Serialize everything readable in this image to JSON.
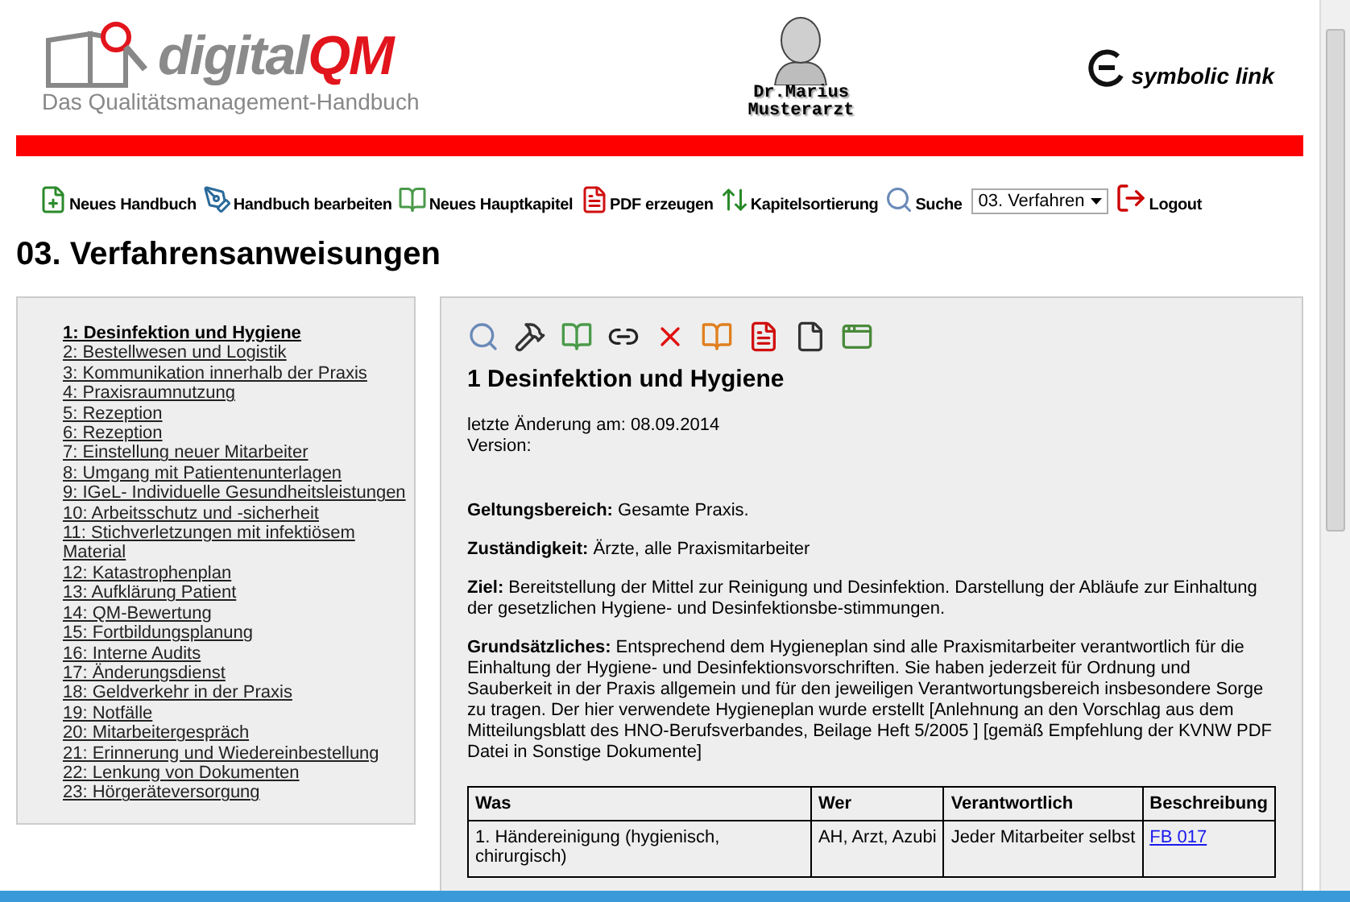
{
  "header": {
    "logo": {
      "brand_plain": "digital",
      "brand_accent": "QM",
      "subtitle": "Das Qualitätsmanagement-Handbuch"
    },
    "center_logo": {
      "line_1": "Dr.Marius",
      "line_2": "Musterarzt"
    },
    "partner_logo": "symbolic link"
  },
  "toolbar": {
    "items": [
      {
        "label": "Neues Handbuch"
      },
      {
        "label": "Handbuch bearbeiten"
      },
      {
        "label": "Neues Hauptkapitel"
      },
      {
        "label": "PDF erzeugen"
      },
      {
        "label": "Kapitelsortierung"
      },
      {
        "label": "Suche"
      }
    ],
    "chapter_select": {
      "value": "03. Verfahren"
    },
    "logout": "Logout"
  },
  "page_title": "03. Verfahrensanweisungen",
  "sidebar": {
    "items": [
      {
        "label": "1: Desinfektion und Hygiene",
        "selected": true
      },
      {
        "label": "2: Bestellwesen und Logistik",
        "selected": false
      },
      {
        "label": "3: Kommunikation innerhalb der Praxis",
        "selected": false
      },
      {
        "label": "4: Praxisraumnutzung",
        "selected": false
      },
      {
        "label": "5: Rezeption",
        "selected": false
      },
      {
        "label": "6: Rezeption",
        "selected": false
      },
      {
        "label": "7: Einstellung neuer Mitarbeiter",
        "selected": false
      },
      {
        "label": "8: Umgang mit Patientenunterlagen",
        "selected": false
      },
      {
        "label": "9: IGeL- Individuelle Gesundheitsleistungen",
        "selected": false
      },
      {
        "label": "10: Arbeitsschutz und -sicherheit",
        "selected": false
      },
      {
        "label": "11: Stichverletzungen mit infektiösem Material",
        "selected": false
      },
      {
        "label": "12: Katastrophenplan",
        "selected": false
      },
      {
        "label": "13: Aufklärung Patient",
        "selected": false
      },
      {
        "label": "14: QM-Bewertung",
        "selected": false
      },
      {
        "label": "15: Fortbildungsplanung",
        "selected": false
      },
      {
        "label": "16: Interne Audits",
        "selected": false
      },
      {
        "label": "17: Änderungsdienst",
        "selected": false
      },
      {
        "label": "18: Geldverkehr in der Praxis",
        "selected": false
      },
      {
        "label": "19: Notfälle",
        "selected": false
      },
      {
        "label": "20: Mitarbeitergespräch",
        "selected": false
      },
      {
        "label": "21: Erinnerung und Wiedereinbestellung",
        "selected": false
      },
      {
        "label": "22: Lenkung von Dokumenten",
        "selected": false
      },
      {
        "label": "23: Hörgeräteversorgung",
        "selected": false
      }
    ]
  },
  "document": {
    "title": "1 Desinfektion und Hygiene",
    "meta": [
      "letzte Änderung am: 08.09.2014",
      "Version:"
    ],
    "sections": [
      "**Geltungsbereich:** Gesamte Praxis.",
      "**Zuständigkeit:** Ärzte, alle Praxismitarbeiter",
      "**Ziel:** Bereitstellung der Mittel zur Reinigung und Desinfektion. Darstellung der Abläufe zur Einhaltung der gesetzlichen Hygiene- und Desinfektionsbe-stimmungen.",
      "**Grundsätzliches:** Entsprechend dem Hygieneplan sind alle Praxismitarbeiter verantwortlich für die Einhaltung der Hygiene- und Desinfektionsvorschriften. Sie haben jederzeit für Ordnung und Sauberkeit in der Praxis allgemein und für den jeweiligen Verantwortungsbereich insbesondere Sorge zu tragen. Der hier verwendete Hygieneplan wurde erstellt [Anlehnung an den Vorschlag aus dem Mitteilungsblatt des HNO-Berufsverbandes, Beilage Heft 5/2005 ] [gemäß Empfehlung der KVNW PDF Datei in Sonstige Dokumente]"
    ],
    "table": {
      "columns": [
        "Was",
        "Wer",
        "Verantwortlich",
        "Beschreibung"
      ],
      "rows": [
        [
          "1. Händereinigung (hygienisch, chirurgisch)",
          "AH, Arzt, Azubi",
          "Jeder Mitarbeiter selbst",
          "FB 017"
        ]
      ]
    }
  }
}
